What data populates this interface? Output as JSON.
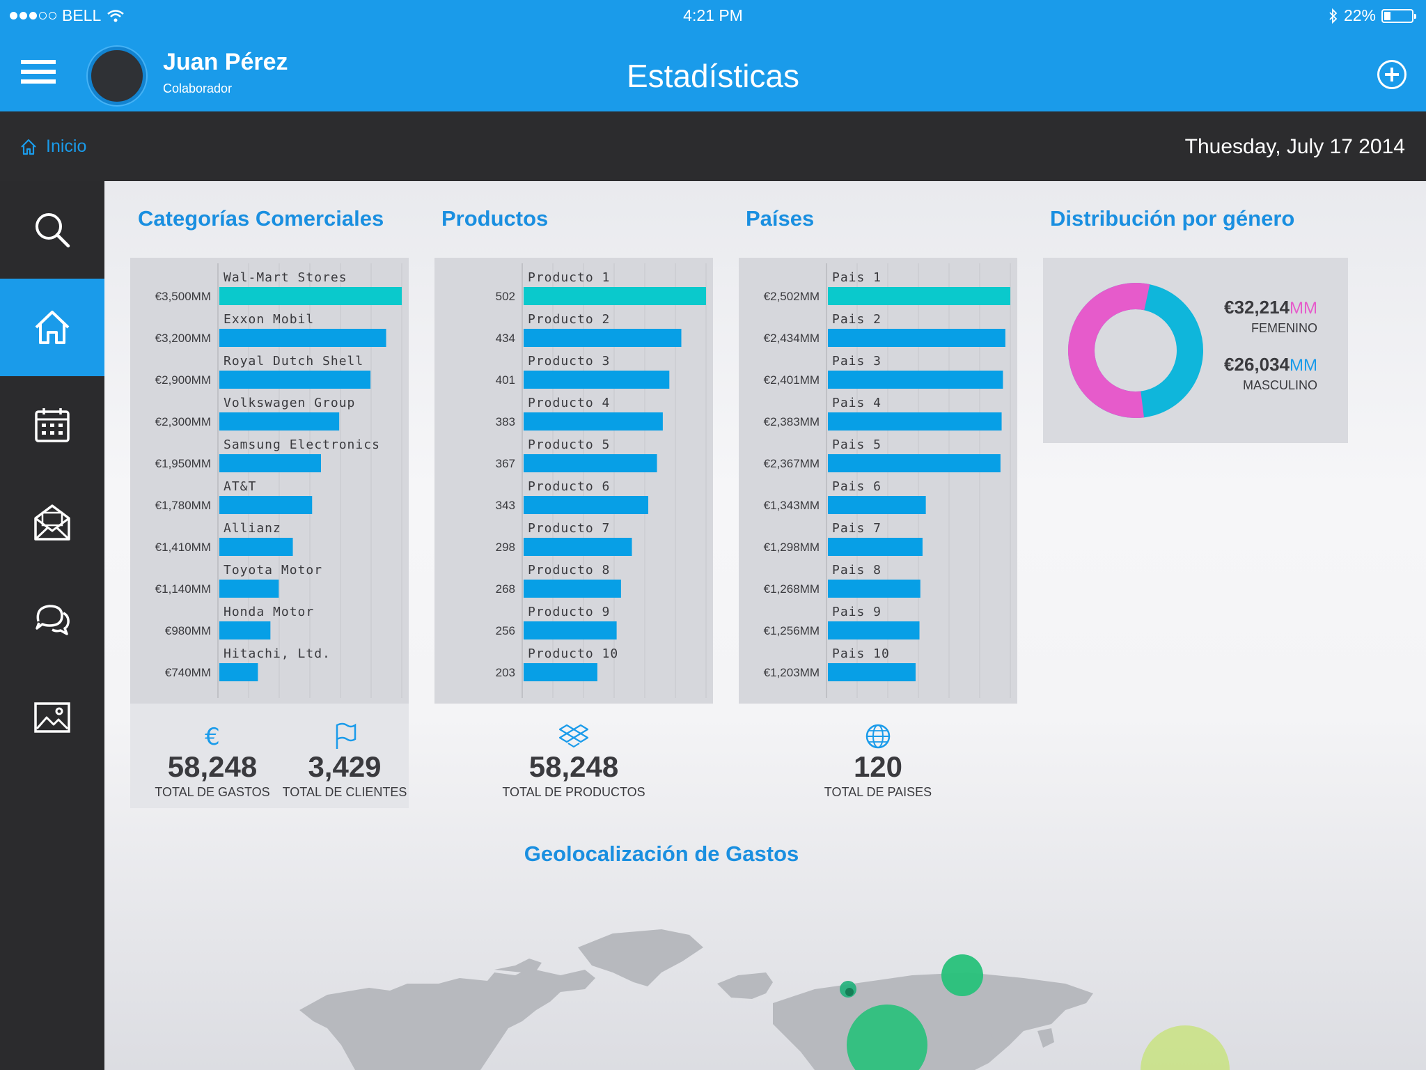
{
  "status": {
    "carrier": "BELL",
    "time": "4:21 PM",
    "battery": "22%"
  },
  "header": {
    "user_name": "Juan Pérez",
    "user_role": "Colaborador",
    "title": "Estadísticas"
  },
  "breadcrumb": {
    "home": "Inicio",
    "date": "Thuesday, July 17 2014"
  },
  "sidebar": {
    "items": [
      "search-icon",
      "home-icon",
      "calendar-icon",
      "mail-icon",
      "chat-icon",
      "image-icon"
    ],
    "active": 1
  },
  "colors": {
    "accent": "#1a9bea",
    "bar_top": "#0ac9cc",
    "bar": "#079fe6",
    "female": "#e65bcb",
    "male": "#0fb6db"
  },
  "sections": {
    "categorias": "Categorías Comerciales",
    "productos": "Productos",
    "paises": "Países",
    "genero": "Distribución por género",
    "geo": "Geolocalización de Gastos"
  },
  "chart_data": [
    {
      "type": "bar",
      "title": "Categorías Comerciales",
      "categories": [
        "Wal-Mart Stores",
        "Exxon Mobil",
        "Royal Dutch Shell",
        "Volkswagen Group",
        "Samsung Electronics",
        "AT&T",
        "Allianz",
        "Toyota Motor",
        "Honda Motor",
        "Hitachi, Ltd."
      ],
      "value_labels": [
        "€3,500MM",
        "€3,200MM",
        "€2,900MM",
        "€2,300MM",
        "€1,950MM",
        "€1,780MM",
        "€1,410MM",
        "€1,140MM",
        "€980MM",
        "€740MM"
      ],
      "values": [
        3500,
        3200,
        2900,
        2300,
        1950,
        1780,
        1410,
        1140,
        980,
        740
      ]
    },
    {
      "type": "bar",
      "title": "Productos",
      "categories": [
        "Producto 1",
        "Producto 2",
        "Producto 3",
        "Producto 4",
        "Producto 5",
        "Producto 6",
        "Producto 7",
        "Producto 8",
        "Producto 9",
        "Producto 10"
      ],
      "value_labels": [
        "502",
        "434",
        "401",
        "383",
        "367",
        "343",
        "298",
        "268",
        "256",
        "203"
      ],
      "values": [
        502,
        434,
        401,
        383,
        367,
        343,
        298,
        268,
        256,
        203
      ]
    },
    {
      "type": "bar",
      "title": "Países",
      "categories": [
        "Pais 1",
        "Pais 2",
        "Pais 3",
        "Pais 4",
        "Pais 5",
        "Pais 6",
        "Pais 7",
        "Pais 8",
        "Pais 9",
        "Pais 10"
      ],
      "value_labels": [
        "€2,502MM",
        "€2,434MM",
        "€2,401MM",
        "€2,383MM",
        "€2,367MM",
        "€1,343MM",
        "€1,298MM",
        "€1,268MM",
        "€1,256MM",
        "€1,203MM"
      ],
      "values": [
        2502,
        2434,
        2401,
        2383,
        2367,
        1343,
        1298,
        1268,
        1256,
        1203
      ]
    },
    {
      "type": "pie",
      "title": "Distribución por género",
      "series": [
        {
          "name": "FEMENINO",
          "value": 32214,
          "display": "€32,214",
          "unit": "MM"
        },
        {
          "name": "MASCULINO",
          "value": 26034,
          "display": "€26,034",
          "unit": "MM"
        }
      ]
    }
  ],
  "totals": {
    "gastos": {
      "value": "58,248",
      "label": "TOTAL DE  GASTOS"
    },
    "clientes": {
      "value": "3,429",
      "label": "TOTAL DE CLIENTES"
    },
    "productos": {
      "value": "58,248",
      "label": "TOTAL DE  PRODUCTOS"
    },
    "paises": {
      "value": "120",
      "label": "TOTAL DE  PAISES"
    }
  }
}
